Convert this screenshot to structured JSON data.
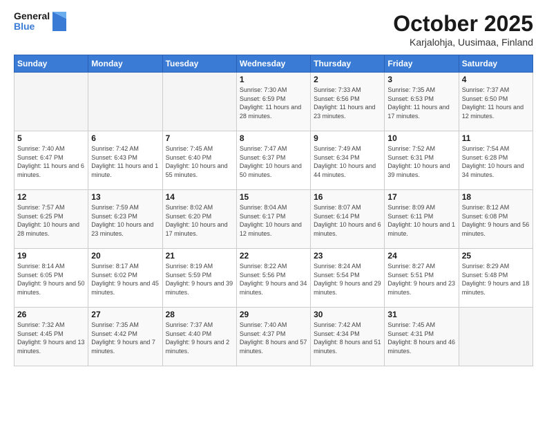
{
  "header": {
    "logo_general": "General",
    "logo_blue": "Blue",
    "month": "October 2025",
    "location": "Karjalohja, Uusimaa, Finland"
  },
  "weekdays": [
    "Sunday",
    "Monday",
    "Tuesday",
    "Wednesday",
    "Thursday",
    "Friday",
    "Saturday"
  ],
  "weeks": [
    [
      {
        "day": "",
        "info": ""
      },
      {
        "day": "",
        "info": ""
      },
      {
        "day": "",
        "info": ""
      },
      {
        "day": "1",
        "info": "Sunrise: 7:30 AM\nSunset: 6:59 PM\nDaylight: 11 hours\nand 28 minutes."
      },
      {
        "day": "2",
        "info": "Sunrise: 7:33 AM\nSunset: 6:56 PM\nDaylight: 11 hours\nand 23 minutes."
      },
      {
        "day": "3",
        "info": "Sunrise: 7:35 AM\nSunset: 6:53 PM\nDaylight: 11 hours\nand 17 minutes."
      },
      {
        "day": "4",
        "info": "Sunrise: 7:37 AM\nSunset: 6:50 PM\nDaylight: 11 hours\nand 12 minutes."
      }
    ],
    [
      {
        "day": "5",
        "info": "Sunrise: 7:40 AM\nSunset: 6:47 PM\nDaylight: 11 hours\nand 6 minutes."
      },
      {
        "day": "6",
        "info": "Sunrise: 7:42 AM\nSunset: 6:43 PM\nDaylight: 11 hours\nand 1 minute."
      },
      {
        "day": "7",
        "info": "Sunrise: 7:45 AM\nSunset: 6:40 PM\nDaylight: 10 hours\nand 55 minutes."
      },
      {
        "day": "8",
        "info": "Sunrise: 7:47 AM\nSunset: 6:37 PM\nDaylight: 10 hours\nand 50 minutes."
      },
      {
        "day": "9",
        "info": "Sunrise: 7:49 AM\nSunset: 6:34 PM\nDaylight: 10 hours\nand 44 minutes."
      },
      {
        "day": "10",
        "info": "Sunrise: 7:52 AM\nSunset: 6:31 PM\nDaylight: 10 hours\nand 39 minutes."
      },
      {
        "day": "11",
        "info": "Sunrise: 7:54 AM\nSunset: 6:28 PM\nDaylight: 10 hours\nand 34 minutes."
      }
    ],
    [
      {
        "day": "12",
        "info": "Sunrise: 7:57 AM\nSunset: 6:25 PM\nDaylight: 10 hours\nand 28 minutes."
      },
      {
        "day": "13",
        "info": "Sunrise: 7:59 AM\nSunset: 6:23 PM\nDaylight: 10 hours\nand 23 minutes."
      },
      {
        "day": "14",
        "info": "Sunrise: 8:02 AM\nSunset: 6:20 PM\nDaylight: 10 hours\nand 17 minutes."
      },
      {
        "day": "15",
        "info": "Sunrise: 8:04 AM\nSunset: 6:17 PM\nDaylight: 10 hours\nand 12 minutes."
      },
      {
        "day": "16",
        "info": "Sunrise: 8:07 AM\nSunset: 6:14 PM\nDaylight: 10 hours\nand 6 minutes."
      },
      {
        "day": "17",
        "info": "Sunrise: 8:09 AM\nSunset: 6:11 PM\nDaylight: 10 hours\nand 1 minute."
      },
      {
        "day": "18",
        "info": "Sunrise: 8:12 AM\nSunset: 6:08 PM\nDaylight: 9 hours\nand 56 minutes."
      }
    ],
    [
      {
        "day": "19",
        "info": "Sunrise: 8:14 AM\nSunset: 6:05 PM\nDaylight: 9 hours\nand 50 minutes."
      },
      {
        "day": "20",
        "info": "Sunrise: 8:17 AM\nSunset: 6:02 PM\nDaylight: 9 hours\nand 45 minutes."
      },
      {
        "day": "21",
        "info": "Sunrise: 8:19 AM\nSunset: 5:59 PM\nDaylight: 9 hours\nand 39 minutes."
      },
      {
        "day": "22",
        "info": "Sunrise: 8:22 AM\nSunset: 5:56 PM\nDaylight: 9 hours\nand 34 minutes."
      },
      {
        "day": "23",
        "info": "Sunrise: 8:24 AM\nSunset: 5:54 PM\nDaylight: 9 hours\nand 29 minutes."
      },
      {
        "day": "24",
        "info": "Sunrise: 8:27 AM\nSunset: 5:51 PM\nDaylight: 9 hours\nand 23 minutes."
      },
      {
        "day": "25",
        "info": "Sunrise: 8:29 AM\nSunset: 5:48 PM\nDaylight: 9 hours\nand 18 minutes."
      }
    ],
    [
      {
        "day": "26",
        "info": "Sunrise: 7:32 AM\nSunset: 4:45 PM\nDaylight: 9 hours\nand 13 minutes."
      },
      {
        "day": "27",
        "info": "Sunrise: 7:35 AM\nSunset: 4:42 PM\nDaylight: 9 hours\nand 7 minutes."
      },
      {
        "day": "28",
        "info": "Sunrise: 7:37 AM\nSunset: 4:40 PM\nDaylight: 9 hours\nand 2 minutes."
      },
      {
        "day": "29",
        "info": "Sunrise: 7:40 AM\nSunset: 4:37 PM\nDaylight: 8 hours\nand 57 minutes."
      },
      {
        "day": "30",
        "info": "Sunrise: 7:42 AM\nSunset: 4:34 PM\nDaylight: 8 hours\nand 51 minutes."
      },
      {
        "day": "31",
        "info": "Sunrise: 7:45 AM\nSunset: 4:31 PM\nDaylight: 8 hours\nand 46 minutes."
      },
      {
        "day": "",
        "info": ""
      }
    ]
  ]
}
